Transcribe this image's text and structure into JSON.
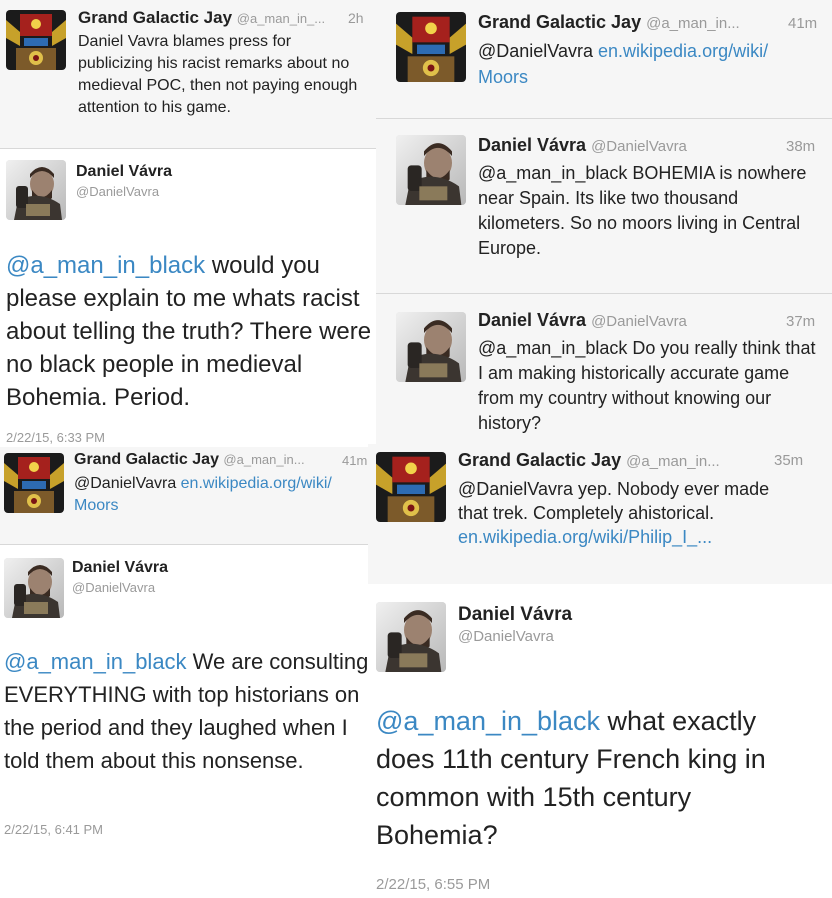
{
  "users": {
    "jay": {
      "name": "Grand Galactic Jay",
      "handle_short": "@a_man_in_..."
    },
    "jay_alt": {
      "name": "Grand Galactic Jay",
      "handle_short": "@a_man_in..."
    },
    "daniel": {
      "name": "Daniel Vávra",
      "handle": "@DanielVavra"
    }
  },
  "tweets": [
    {
      "time": "2h",
      "text": "Daniel Vavra blames press for publicizing his racist remarks about no medieval POC, then not paying enough attention to his game."
    },
    {
      "mention": "@a_man_in_black",
      "text": " would you please explain to me whats racist about telling the truth? There were no black people in medieval Bohemia. Period.",
      "date": "2/22/15, 6:33 PM"
    },
    {
      "time": "41m",
      "text": "@DanielVavra ",
      "link": "en.wikipedia.org/wiki/ Moors"
    },
    {
      "mention": "@a_man_in_black",
      "text": " We are consulting EVERYTHING with top historians on the period and they laughed when I told them about this nonsense.",
      "date": "2/22/15, 6:41 PM"
    },
    {
      "time": "41m",
      "text": "@DanielVavra ",
      "link": "en.wikipedia.org/wiki/ Moors"
    },
    {
      "time": "38m",
      "text": "@a_man_in_black BOHEMIA is nowhere near Spain. Its like two thousand kilometers. So no moors living in Central Europe."
    },
    {
      "time": "37m",
      "text": "@a_man_in_black Do you really think that I am making historically accurate game from my country without knowing our history?"
    },
    {
      "time": "35m",
      "text": "@DanielVavra yep. Nobody ever made that trek. Completely ahistorical. ",
      "link": "en.wikipedia.org/wiki/Philip_I_..."
    },
    {
      "mention": "@a_man_in_black",
      "text": " what exactly does 11th century French king in common with 15th century Bohemia?",
      "date": "2/22/15, 6:55 PM"
    }
  ],
  "colors": {
    "link": "#3b88c3",
    "meta": "#9a9a9a",
    "text": "#222222",
    "divider": "#d8d8d8"
  }
}
